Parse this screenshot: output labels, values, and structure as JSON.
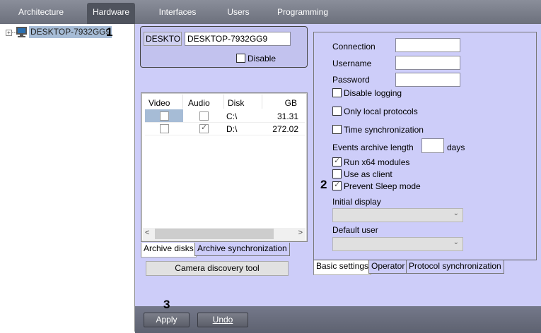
{
  "tabs": [
    {
      "label": "Architecture"
    },
    {
      "label": "Hardware",
      "active": true
    },
    {
      "label": "Interfaces"
    },
    {
      "label": "Users"
    },
    {
      "label": "Programming"
    }
  ],
  "tree": {
    "node_label": "DESKTOP-7932GG9",
    "expander": "+"
  },
  "callouts": {
    "one": "1",
    "two": "2",
    "three": "3"
  },
  "device": {
    "name_label": "DESKTOF",
    "name_value": "DESKTOP-7932GG9",
    "disable_label": "Disable",
    "disable_checked": false
  },
  "disks": {
    "headers": [
      "Video",
      "Audio",
      "Disk",
      "GB"
    ],
    "rows": [
      {
        "disk": "C:\\",
        "gb": "31.31",
        "video": false,
        "audio": false
      },
      {
        "disk": "D:\\",
        "gb": "272.02",
        "video": false,
        "audio": true
      }
    ],
    "tabs": [
      "Archive disks",
      "Archive synchronization"
    ],
    "scroll_left": "<",
    "scroll_right": ">"
  },
  "camera_discovery_label": "Camera discovery tool",
  "settings": {
    "connection_label": "Connection",
    "connection_value": "",
    "username_label": "Username",
    "username_value": "",
    "password_label": "Password",
    "password_value": "",
    "disable_logging": "Disable logging",
    "only_local": "Only local protocols",
    "time_sync": "Time synchronization",
    "events_archive_label": "Events archive length",
    "events_archive_value": "",
    "days_label": "days",
    "run_x64": "Run x64 modules",
    "use_as_client": "Use as client",
    "prevent_sleep": "Prevent Sleep mode",
    "initial_display_label": "Initial display",
    "initial_display_value": "",
    "default_user_label": "Default user",
    "default_user_value": "",
    "tabs": [
      "Basic settings",
      "Operator",
      "Protocol synchronization"
    ]
  },
  "buttons": {
    "apply": "Apply",
    "undo": "Undo"
  },
  "colors": {
    "panel": "#cdcdf9",
    "topbar": "#6c707c",
    "selection": "#a6bcd6"
  }
}
